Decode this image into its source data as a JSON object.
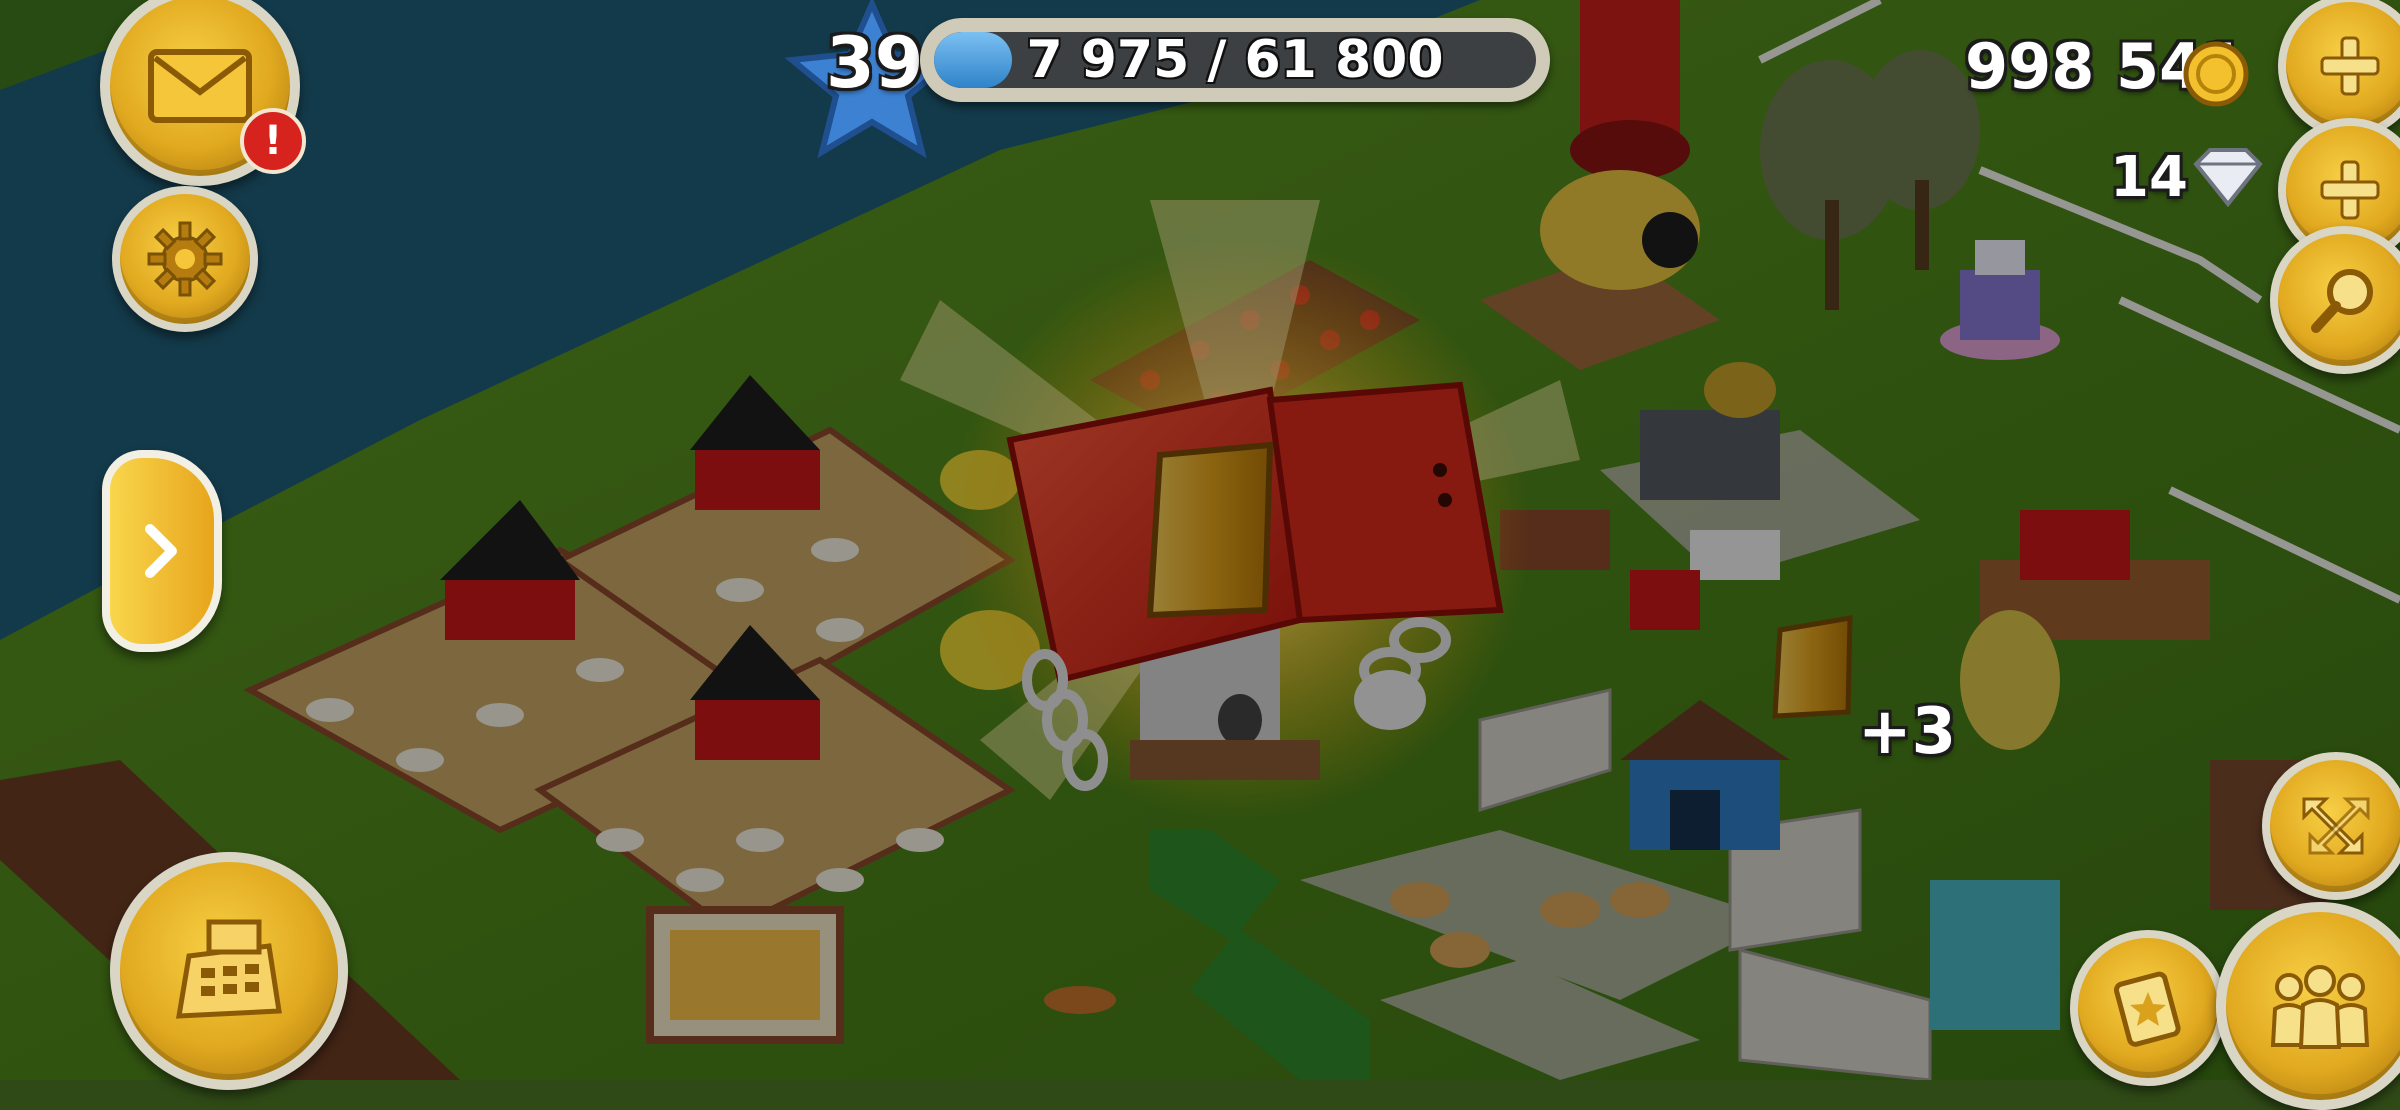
{
  "hud": {
    "level": "39",
    "xp_text": "7 975 / 61 800",
    "xp_progress": 0.129,
    "coins": "998 541",
    "diamonds": "14",
    "notification_badge": "!"
  },
  "reward": {
    "amount_text": "+3"
  },
  "icons": {
    "mail": "envelope-icon",
    "settings": "gear-icon",
    "expand": "chevron-right-icon",
    "shop": "cash-register-icon",
    "add_coins": "plus-icon",
    "add_diamonds": "plus-icon",
    "search": "magnifier-icon",
    "zoom": "expand-arrows-icon",
    "card": "star-card-icon",
    "friends": "people-icon",
    "coin": "coin-icon",
    "diamond": "diamond-icon"
  },
  "colors": {
    "gold": "#e1a91f",
    "button_ring": "#d9d6c6",
    "xp_fill": "#2f83c9",
    "alert_red": "#d6231d",
    "chest_red": "#e32b1e"
  }
}
